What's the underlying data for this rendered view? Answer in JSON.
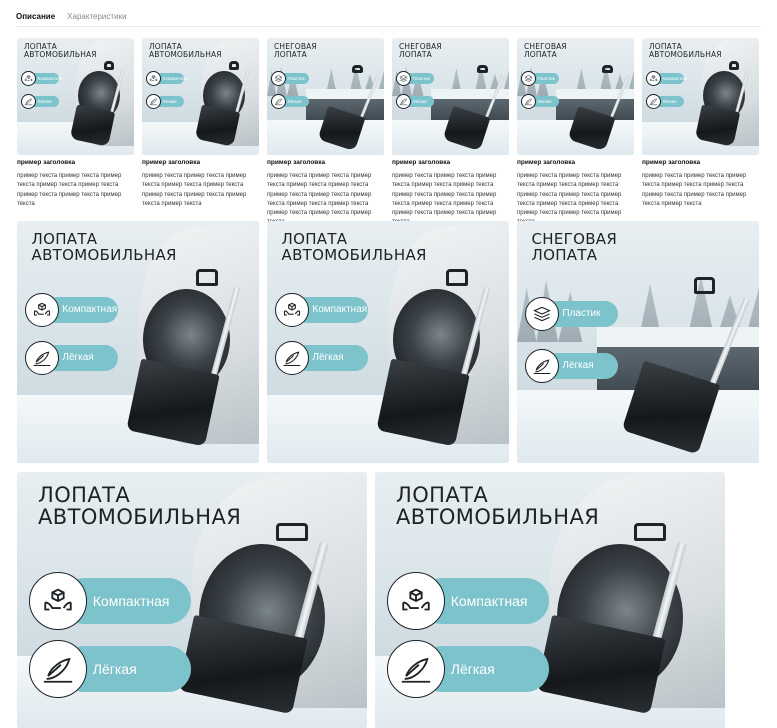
{
  "tabs": [
    {
      "label": "Описание",
      "active": true
    },
    {
      "label": "Характеристики",
      "active": false
    }
  ],
  "thumbs": [
    {
      "title_line1": "ЛОПАТА",
      "title_line2": "АВТОМОБИЛЬНАЯ",
      "badge1": "Компактная",
      "badge2": "Лёгкая",
      "heading": "пример заголовка",
      "text": "пример текста пример текста пример текста пример текста пример текста пример текста пример текста пример текста"
    },
    {
      "title_line1": "ЛОПАТА",
      "title_line2": "АВТОМОБИЛЬНАЯ",
      "badge1": "Компактная",
      "badge2": "Лёгкая",
      "heading": "пример заголовка",
      "text": "пример текста пример текста пример текста пример текста пример текста пример текста пример текста пример текста пример текста"
    },
    {
      "title_line1": "СНЕГОВАЯ",
      "title_line2": "ЛОПАТА",
      "badge1": "Пластик",
      "badge2": "Лёгкая",
      "heading": "пример заголовка",
      "text": "пример текста пример текста пример текста пример текста пример текста пример текста пример текста пример текста пример текста пример текста пример текста пример текста пример текста"
    },
    {
      "title_line1": "СНЕГОВАЯ",
      "title_line2": "ЛОПАТА",
      "badge1": "Пластик",
      "badge2": "Лёгкая",
      "heading": "пример заголовка",
      "text": "пример текста пример текста пример текста пример текста пример текста пример текста пример текста пример текста пример текста пример текста пример текста пример текста пример текста"
    },
    {
      "title_line1": "СНЕГОВАЯ",
      "title_line2": "ЛОПАТА",
      "badge1": "Пластик",
      "badge2": "Лёгкая",
      "heading": "пример заголовка",
      "text": "пример текста пример текста пример текста пример текста пример текста пример текста пример текста пример текста пример текста пример текста пример текста пример текста пример текста"
    },
    {
      "title_line1": "ЛОПАТА",
      "title_line2": "АВТОМОБИЛЬНАЯ",
      "badge1": "Компактная",
      "badge2": "Лёгкая",
      "heading": "пример заголовка",
      "text": "пример текста пример текста пример текста пример текста пример текста пример текста пример текста пример текста пример текста"
    }
  ],
  "medium": [
    {
      "title_line1": "ЛОПАТА",
      "title_line2": "АВТОМОБИЛЬНАЯ",
      "badge1": "Компактная",
      "badge2": "Лёгкая"
    },
    {
      "title_line1": "ЛОПАТА",
      "title_line2": "АВТОМОБИЛЬНАЯ",
      "badge1": "Компактная",
      "badge2": "Лёгкая"
    },
    {
      "title_line1": "СНЕГОВАЯ",
      "title_line2": "ЛОПАТА",
      "badge1": "Пластик",
      "badge2": "Лёгкая"
    }
  ],
  "large": [
    {
      "title_line1": "ЛОПАТА",
      "title_line2": "АВТОМОБИЛЬНАЯ",
      "badge1": "Компактная",
      "badge2": "Лёгкая"
    },
    {
      "title_line1": "ЛОПАТА",
      "title_line2": "АВТОМОБИЛЬНАЯ",
      "badge1": "Компактная",
      "badge2": "Лёгкая"
    }
  ],
  "colors": {
    "accent_pill": "#7cc3cc",
    "tab_active": "#111111",
    "tab_inactive": "#8a8a8a"
  },
  "icons": {
    "compact": "box-in-hands-icon",
    "plastic": "stacked-layers-icon",
    "light": "feather-icon"
  }
}
